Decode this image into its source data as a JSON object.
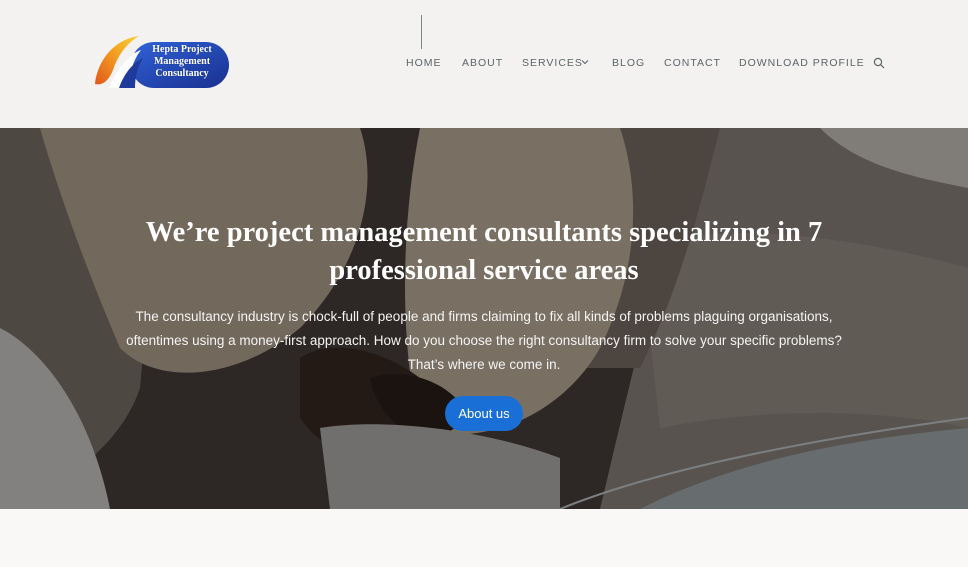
{
  "logo": {
    "line1": "Hepta Project",
    "line2": "Management",
    "line3": "Consultancy"
  },
  "nav": {
    "items": [
      {
        "label": "HOME"
      },
      {
        "label": "ABOUT"
      },
      {
        "label": "SERVICES"
      },
      {
        "label": "BLOG"
      },
      {
        "label": "CONTACT"
      },
      {
        "label": "DOWNLOAD PROFILE"
      }
    ],
    "services_dropdown_icon": "chevron-down-icon",
    "search_icon": "search-icon"
  },
  "hero": {
    "title": "We’re project management consultants specializing in 7 professional service areas",
    "text": "The consultancy industry is chock-full of people and firms claiming to fix all kinds of problems plaguing organisations, oftentimes using a money-first approach. How do you choose the right consultancy firm to solve your specific problems? That’s where we come in.",
    "button_label": "About us"
  },
  "colors": {
    "header_bg": "#f3f2f1",
    "nav_text": "#5b6568",
    "button_bg": "#1a6fd6",
    "logo_blue": "#1f3a9a",
    "logo_orange": "#f08a1c"
  }
}
